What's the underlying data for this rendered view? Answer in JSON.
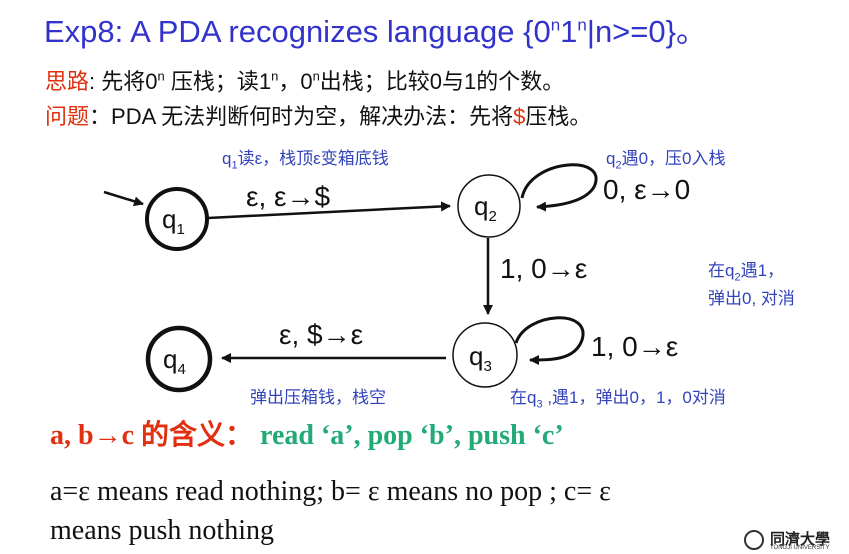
{
  "title": {
    "prefix": "Exp8:  A PDA  recognizes language {0",
    "sup_n1": "n",
    "middle": "1",
    "sup_n2": "n",
    "suffix": "|n>=0}。"
  },
  "idea": {
    "label": "思路",
    "colon": ":  先将0",
    "sup1": "n",
    "text1": " 压栈；读1",
    "sup2": "n",
    "text2": "，0",
    "sup3": "n",
    "text3": "出栈；比较0与1的个数。"
  },
  "problem": {
    "label": "问题",
    "text_a": "：PDA 无法判断何时为空，解决办法：先将",
    "dollar": "$",
    "text_b": "压栈。"
  },
  "states": [
    {
      "name": "q",
      "sub": "1"
    },
    {
      "name": "q",
      "sub": "2"
    },
    {
      "name": "q",
      "sub": "3"
    },
    {
      "name": "q",
      "sub": "4"
    }
  ],
  "transitions": {
    "q1_q2": "ε, ε→$",
    "q2_loop": "0, ε→0",
    "q2_q3": "1, 0→ε",
    "q3_loop": "1, 0→ε",
    "q3_q4": "ε, $→ε"
  },
  "notes": {
    "q1": {
      "a": "q",
      "sub": "1",
      "b": "读ε，栈顶ε变箱底钱"
    },
    "q2": {
      "a": "q",
      "sub": "2",
      "b": "遇0，压0入栈"
    },
    "q2q3_l1a": "在q",
    "q2q3_sub": "2",
    "q2q3_l1b": "遇1，",
    "q2q3_l2": "弹出0, 对消",
    "q3q4": "弹出压箱钱，栈空",
    "q3": {
      "a": "在q",
      "sub": "3",
      "b": " ,遇1，弹出0，1，0对消"
    }
  },
  "meaning": {
    "label": "a, b→c 的含义：",
    "desc": "read ‘a’, pop ‘b’,  push ‘c’"
  },
  "epsilon_line1": "a=ε means read nothing;  b= ε means no pop ;  c= ε",
  "epsilon_line2": "means push nothing",
  "logo": {
    "name": "同濟大學",
    "en": "TONGJI UNIVERSITY"
  }
}
